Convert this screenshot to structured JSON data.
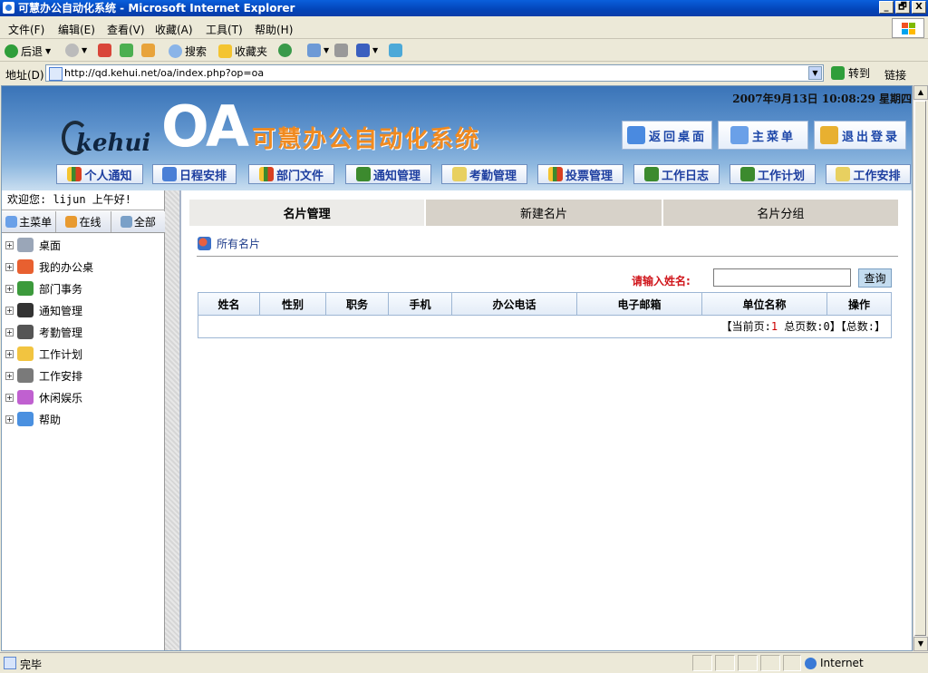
{
  "window": {
    "title": "可慧办公自动化系统 - Microsoft Internet Explorer",
    "minimize": "_",
    "maximize": "🗗",
    "close": "X"
  },
  "menu": [
    "文件(F)",
    "编辑(E)",
    "查看(V)",
    "收藏(A)",
    "工具(T)",
    "帮助(H)"
  ],
  "toolbar": {
    "back": "后退",
    "search": "搜索",
    "favorites": "收藏夹"
  },
  "address": {
    "label": "地址(D)",
    "url": "http://qd.kehui.net/oa/index.php?op=oa",
    "go": "转到",
    "links": "链接"
  },
  "header": {
    "datetime": "2007年9月13日  10:08:29  星期四",
    "logo_text": "kehui",
    "oa_text": "OA",
    "system_name": "可慧办公自动化系统",
    "buttons": [
      "返回桌面",
      "主菜单",
      "退出登录"
    ]
  },
  "nav": [
    "个人通知",
    "日程安排",
    "部门文件",
    "通知管理",
    "考勤管理",
    "投票管理",
    "工作日志",
    "工作计划",
    "工作安排"
  ],
  "sidebar": {
    "welcome": "欢迎您: lijun 上午好!",
    "tabs": [
      "主菜单",
      "在线",
      "全部"
    ],
    "tree": [
      {
        "label": "桌面",
        "icon": "desktop-icon"
      },
      {
        "label": "我的办公桌",
        "icon": "windows-flag-icon"
      },
      {
        "label": "部门事务",
        "icon": "house-icon"
      },
      {
        "label": "通知管理",
        "icon": "floppy-icon"
      },
      {
        "label": "考勤管理",
        "icon": "camera-icon"
      },
      {
        "label": "工作计划",
        "icon": "folder-icon"
      },
      {
        "label": "工作安排",
        "icon": "calendar-icon"
      },
      {
        "label": "休闲娱乐",
        "icon": "games-icon"
      },
      {
        "label": "帮助",
        "icon": "help-globe-icon"
      }
    ]
  },
  "main": {
    "tabs": [
      "名片管理",
      "新建名片",
      "名片分组"
    ],
    "active_tab": "名片管理",
    "all_cards": "所有名片",
    "search_label": "请输入姓名:",
    "search_value": "",
    "search_button": "查询",
    "columns": [
      "姓名",
      "性别",
      "职务",
      "手机",
      "办公电话",
      "电子邮箱",
      "单位名称",
      "操作"
    ],
    "pager": {
      "prefix": "【当前页:",
      "current": "1",
      "total_pages_label": " 总页数:",
      "total_pages": "0",
      "total_label": "】【总数:",
      "total": "",
      "suffix": "】"
    }
  },
  "status": {
    "done": "完毕",
    "zone": "Internet"
  },
  "colors": {
    "title_blue": "#0344b8",
    "banner_blue": "#5d92cc",
    "orange": "#f08a20",
    "red_label": "#d0161c"
  }
}
